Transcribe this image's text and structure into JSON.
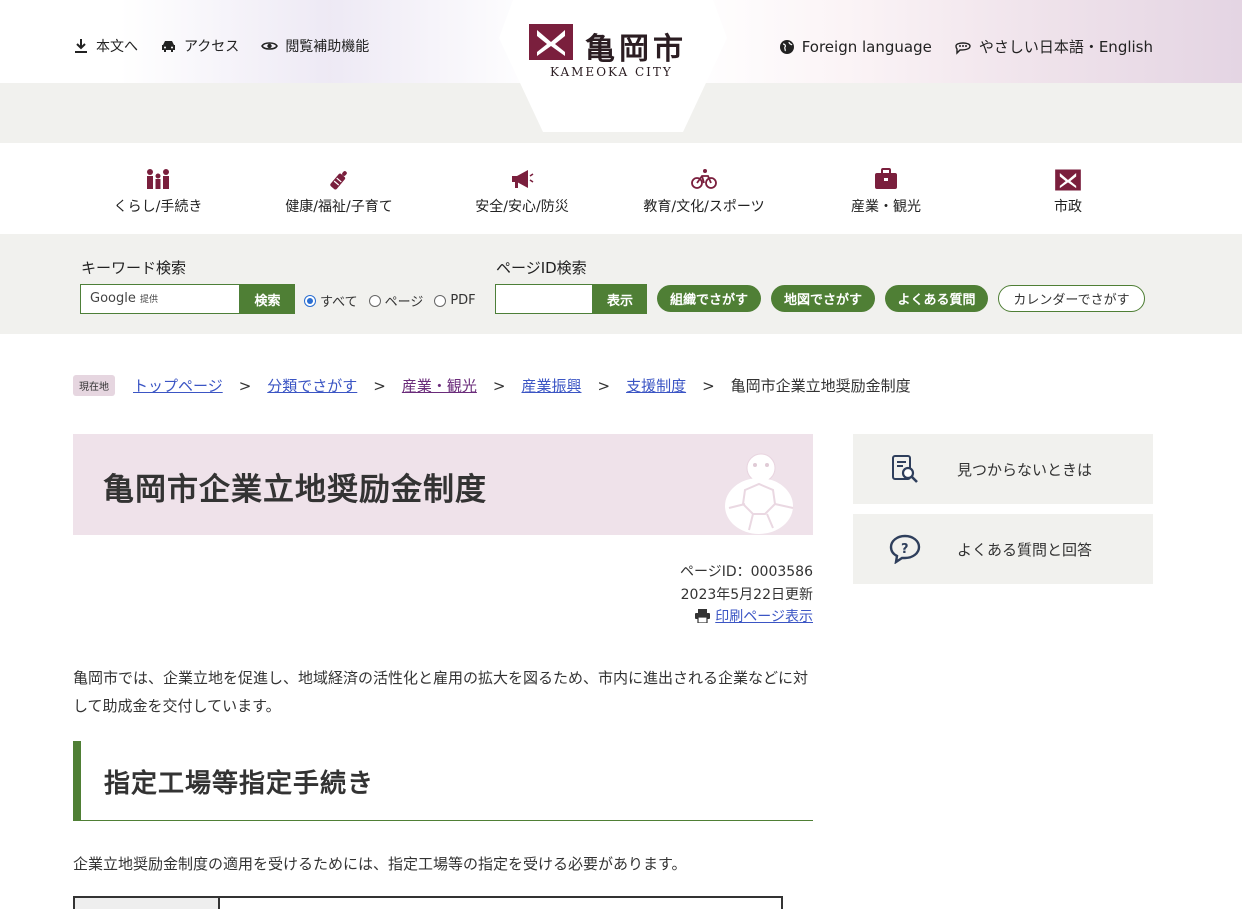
{
  "header": {
    "links_left": [
      {
        "label": "本文へ",
        "icon": "download-icon"
      },
      {
        "label": "アクセス",
        "icon": "car-icon"
      },
      {
        "label": "閲覧補助機能",
        "icon": "eye-icon"
      }
    ],
    "logo": {
      "jp": "亀岡市",
      "en": "KAMEOKA CITY"
    },
    "links_right": [
      {
        "label": "Foreign language",
        "icon": "globe-icon"
      },
      {
        "label": "やさしい日本語・English",
        "icon": "speech-bubble-icon"
      }
    ]
  },
  "categories": [
    {
      "label": "くらし/手続き",
      "icon": "family-icon"
    },
    {
      "label": "健康/福祉/子育て",
      "icon": "baby-bottle-icon"
    },
    {
      "label": "安全/安心/防災",
      "icon": "megaphone-icon"
    },
    {
      "label": "教育/文化/スポーツ",
      "icon": "bicycle-icon"
    },
    {
      "label": "産業・観光",
      "icon": "briefcase-icon"
    },
    {
      "label": "市政",
      "icon": "city-emblem-icon"
    }
  ],
  "search": {
    "keyword_label": "キーワード検索",
    "google_text": "Google",
    "google_sub": "提供",
    "search_button": "検索",
    "radio_options": [
      "すべて",
      "ページ",
      "PDF"
    ],
    "radio_selected": "すべて",
    "pageid_label": "ページID検索",
    "show_button": "表示",
    "pills": [
      "組織でさがす",
      "地図でさがす",
      "よくある質問",
      "カレンダーでさがす"
    ]
  },
  "breadcrumb": {
    "here_badge": "現在地",
    "items": [
      "トップページ",
      "分類でさがす",
      "産業・観光",
      "産業振興",
      "支援制度"
    ],
    "current": "亀岡市企業立地奨励金制度",
    "separator": ">"
  },
  "page": {
    "title": "亀岡市企業立地奨励金制度",
    "page_id": "ページID：0003586",
    "updated": "2023年5月22日更新",
    "print_link": "印刷ページ表示",
    "lead": "亀岡市では、企業立地を促進し、地域経済の活性化と雇用の拡大を図るため、市内に進出される企業などに対して助成金を交付しています。",
    "section_heading": "指定工場等指定手続き",
    "section_text": "企業立地奨励金制度の適用を受けるためには、指定工場等の指定を受ける必要があります。"
  },
  "sidebar": [
    {
      "label": "見つからないときは",
      "icon": "document-search-icon"
    },
    {
      "label": "よくある質問と回答",
      "icon": "question-bubble-icon"
    }
  ],
  "colors": {
    "brand_green": "#4f7f35",
    "brand_maroon": "#7a1f3d",
    "title_bg": "#efe2ea",
    "band_bg": "#f1f1ee"
  }
}
